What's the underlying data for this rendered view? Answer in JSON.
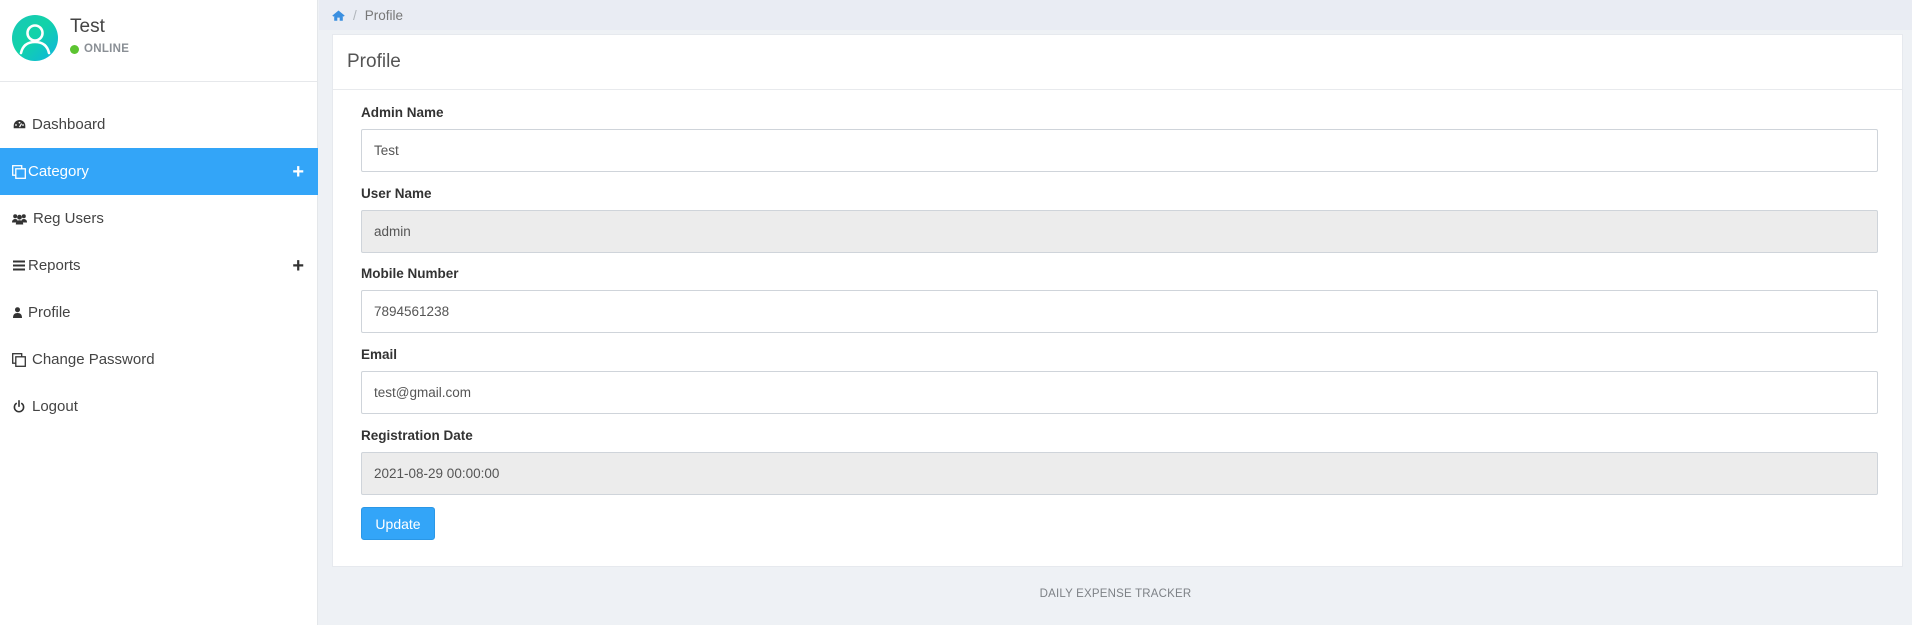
{
  "user": {
    "name": "Test",
    "status": "ONLINE",
    "status_color": "#5cc431"
  },
  "sidebar": {
    "items": [
      {
        "label": "Dashboard",
        "icon": "dashboard-icon",
        "active": false,
        "expandable": false
      },
      {
        "label": "Category",
        "icon": "copy-icon",
        "active": true,
        "expandable": true
      },
      {
        "label": "Reg Users",
        "icon": "users-icon",
        "active": false,
        "expandable": false
      },
      {
        "label": "Reports",
        "icon": "list-icon",
        "active": false,
        "expandable": true
      },
      {
        "label": "Profile",
        "icon": "user-icon",
        "active": false,
        "expandable": false
      },
      {
        "label": "Change Password",
        "icon": "copy-icon",
        "active": false,
        "expandable": false
      },
      {
        "label": "Logout",
        "icon": "power-icon",
        "active": false,
        "expandable": false
      }
    ],
    "expand_symbol": "+"
  },
  "breadcrumb": {
    "home_icon": "home-icon",
    "separator": "/",
    "current": "Profile"
  },
  "panel": {
    "title": "Profile"
  },
  "form": {
    "admin_name": {
      "label": "Admin Name",
      "value": "Test",
      "readonly": false
    },
    "user_name": {
      "label": "User Name",
      "value": "admin",
      "readonly": true
    },
    "mobile_number": {
      "label": "Mobile Number",
      "value": "7894561238",
      "readonly": false
    },
    "email": {
      "label": "Email",
      "value": "test@gmail.com",
      "readonly": false
    },
    "registration_date": {
      "label": "Registration Date",
      "value": "2021-08-29 00:00:00",
      "readonly": true
    },
    "update_label": "Update"
  },
  "footer": {
    "text": "DAILY EXPENSE TRACKER"
  },
  "colors": {
    "accent": "#33a5f8",
    "page_bg": "#eef1f5",
    "readonly_bg": "#ececec"
  }
}
